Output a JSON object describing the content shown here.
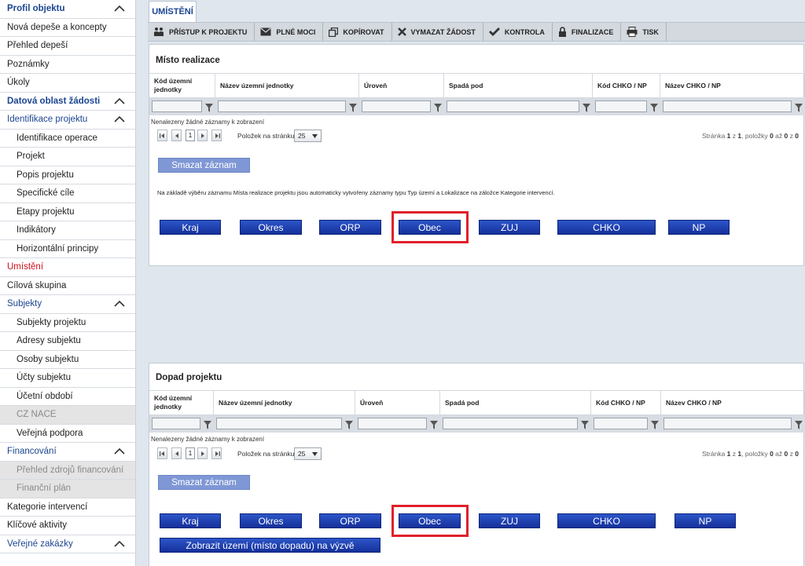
{
  "sidebar": {
    "items": [
      {
        "label": "Profil objektu",
        "kind": "header",
        "collapsible": true
      },
      {
        "label": "Nová depeše a koncepty",
        "kind": "item"
      },
      {
        "label": "Přehled depeší",
        "kind": "item"
      },
      {
        "label": "Poznámky",
        "kind": "item"
      },
      {
        "label": "Úkoly",
        "kind": "item"
      },
      {
        "label": "Datová oblast žádosti",
        "kind": "header",
        "collapsible": true
      },
      {
        "label": "Identifikace projektu",
        "kind": "header-light",
        "collapsible": true
      },
      {
        "label": "Identifikace operace",
        "kind": "sub"
      },
      {
        "label": "Projekt",
        "kind": "sub"
      },
      {
        "label": "Popis projektu",
        "kind": "sub"
      },
      {
        "label": "Specifické cíle",
        "kind": "sub"
      },
      {
        "label": "Etapy projektu",
        "kind": "sub"
      },
      {
        "label": "Indikátory",
        "kind": "sub"
      },
      {
        "label": "Horizontální principy",
        "kind": "sub"
      },
      {
        "label": "Umístění",
        "kind": "active"
      },
      {
        "label": "Cílová skupina",
        "kind": "item"
      },
      {
        "label": "Subjekty",
        "kind": "header-light",
        "collapsible": true
      },
      {
        "label": "Subjekty projektu",
        "kind": "sub"
      },
      {
        "label": "Adresy subjektu",
        "kind": "sub"
      },
      {
        "label": "Osoby subjektu",
        "kind": "sub"
      },
      {
        "label": "Účty subjektu",
        "kind": "sub"
      },
      {
        "label": "Účetní období",
        "kind": "sub"
      },
      {
        "label": "CZ NACE",
        "kind": "sub-disabled"
      },
      {
        "label": "Veřejná podpora",
        "kind": "sub"
      },
      {
        "label": "Financování",
        "kind": "header-light",
        "collapsible": true
      },
      {
        "label": "Přehled zdrojů financování",
        "kind": "sub-disabled"
      },
      {
        "label": "Finanční plán",
        "kind": "sub-disabled"
      },
      {
        "label": "Kategorie intervencí",
        "kind": "item"
      },
      {
        "label": "Klíčové aktivity",
        "kind": "item"
      },
      {
        "label": "Veřejné zakázky",
        "kind": "header-light",
        "collapsible": true
      }
    ]
  },
  "tab": {
    "label": "UMÍSTĚNÍ"
  },
  "toolbar": {
    "buttons": [
      {
        "label": "PŘÍSTUP K PROJEKTU",
        "icon": "people-icon"
      },
      {
        "label": "PLNÉ MOCI",
        "icon": "envelope-icon"
      },
      {
        "label": "KOPÍROVAT",
        "icon": "copy-icon"
      },
      {
        "label": "VYMAZAT ŽÁDOST",
        "icon": "x-icon"
      },
      {
        "label": "KONTROLA",
        "icon": "check-icon"
      },
      {
        "label": "FINALIZACE",
        "icon": "lock-icon"
      },
      {
        "label": "TISK",
        "icon": "printer-icon"
      }
    ]
  },
  "section1": {
    "title": "Místo realizace",
    "columns": [
      "Kód územní jednotky",
      "Název územní jednotky",
      "Úroveň",
      "Spadá pod",
      "Kód CHKO / NP",
      "Název CHKO / NP"
    ],
    "empty_message": "Nenalezeny žádné záznamy k zobrazení",
    "pager": {
      "page": "1",
      "per_page_label": "Položek na stránku",
      "per_page": "25",
      "info_prefix": "Stránka",
      "page_cur": "1",
      "page_of": "z",
      "page_total": "1",
      "items_label": ", položky",
      "from": "0",
      "to_word": "až",
      "to": "0",
      "of_word": "z",
      "total": "0"
    },
    "delete_button": "Smazat záznam",
    "info_text": "Na základě výběru záznamu Místa realizace projektu jsou automaticky vytvořeny záznamy typu Typ území a Lokalizace na záložce Kategorie intervencí.",
    "buttons": [
      "Kraj",
      "Okres",
      "ORP",
      "Obec",
      "ZUJ",
      "CHKO",
      "NP"
    ],
    "highlighted": "Obec"
  },
  "section2": {
    "title": "Dopad projektu",
    "columns": [
      "Kód územní jednotky",
      "Název územní jednotky",
      "Úroveň",
      "Spadá pod",
      "Kód CHKO / NP",
      "Název CHKO / NP"
    ],
    "empty_message": "Nenalezeny žádné záznamy k zobrazení",
    "pager": {
      "page": "1",
      "per_page_label": "Položek na stránku",
      "per_page": "25",
      "info_prefix": "Stránka",
      "page_cur": "1",
      "page_of": "z",
      "page_total": "1",
      "items_label": ", položky",
      "from": "0",
      "to_word": "až",
      "to": "0",
      "of_word": "z",
      "total": "0"
    },
    "delete_button": "Smazat záznam",
    "buttons": [
      "Kraj",
      "Okres",
      "ORP",
      "Obec",
      "ZUJ",
      "CHKO",
      "NP"
    ],
    "highlighted": "Obec",
    "show_button": "Zobrazit území (místo dopadu) na výzvě"
  },
  "colors": {
    "accent": "#1b4591",
    "active": "#d0101b",
    "button": "#1f3fb0",
    "highlight": "#e0202a"
  }
}
